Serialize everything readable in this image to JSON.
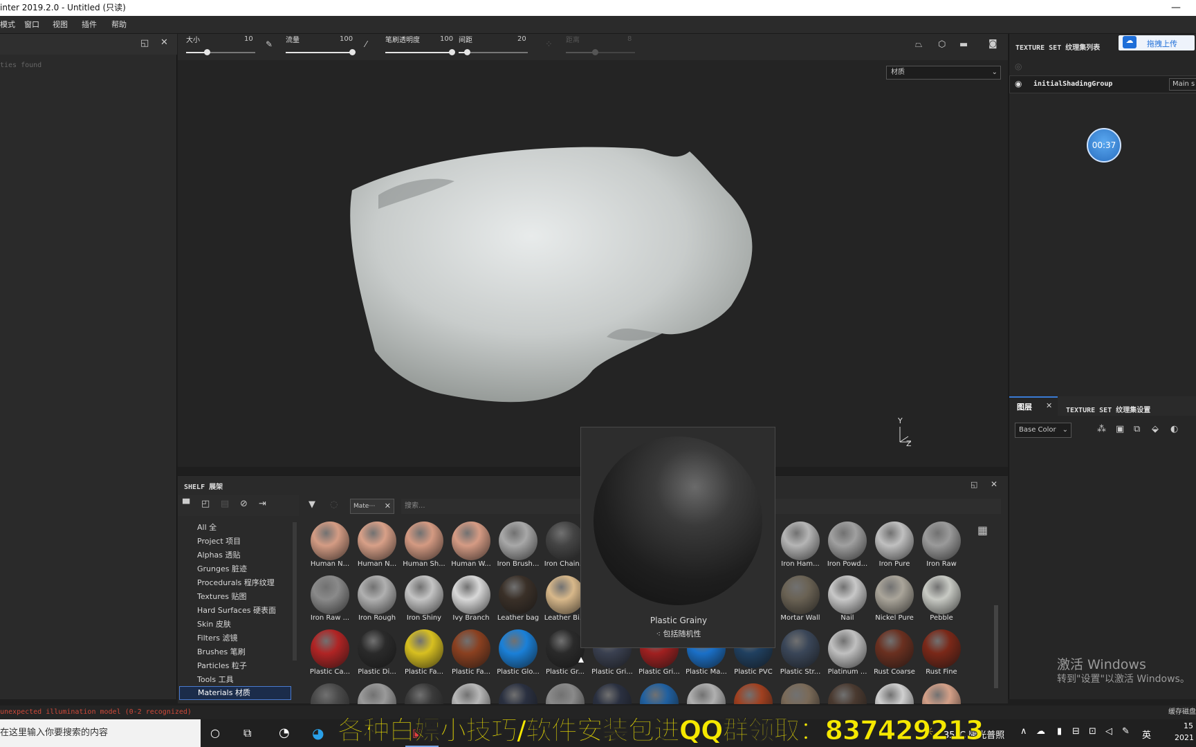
{
  "titlebar": {
    "title": "inter 2019.2.0 - Untitled (只读)",
    "minimize": "—"
  },
  "menu": [
    "模式",
    "窗口",
    "视图",
    "插件",
    "帮助"
  ],
  "leftpanel": {
    "not_found": "ties found"
  },
  "toolbar": {
    "size_label": "大小",
    "size_value": "10",
    "flow_label": "流量",
    "flow_value": "100",
    "opacity_label": "笔刷透明度",
    "opacity_value": "100",
    "spacing_label": "间距",
    "spacing_value": "20",
    "distance_label": "距离",
    "distance_value": "8"
  },
  "viewport": {
    "material_select": "材质",
    "axis_y": "Y",
    "axis_z": "Z"
  },
  "rightpanel": {
    "upload_button": "拖拽上传",
    "texture_set_list_title": "TEXTURE SET 纹理集列表",
    "shading_group": "initialShadingGroup",
    "main_label": "Main s",
    "timer": "00:37",
    "layers_tab": "图层",
    "settings_tab": "TEXTURE SET 纹理集设置",
    "channel": "Base Color"
  },
  "shelf": {
    "title": "SHELF 展架",
    "tag": "Mate⋯",
    "search_placeholder": "搜索...",
    "categories": [
      "All 全",
      "Project 项目",
      "Alphas 透贴",
      "Grunges 脏迹",
      "Procedurals 程序纹理",
      "Textures 贴图",
      "Hard Surfaces 硬表面",
      "Skin 皮肤",
      "Filters 滤镜",
      "Brushes 笔刷",
      "Particles 粒子",
      "Tools 工具",
      "Materials 材质"
    ],
    "rows": [
      [
        {
          "name": "Human N...",
          "color": "#d49c84"
        },
        {
          "name": "Human N...",
          "color": "#d8a088"
        },
        {
          "name": "Human Sh...",
          "color": "#d49a82"
        },
        {
          "name": "Human W...",
          "color": "#d59b84"
        },
        {
          "name": "Iron Brush...",
          "color": "#a8a8a8"
        },
        {
          "name": "Iron Chain...",
          "color": "#444444"
        },
        {
          "name": "",
          "color": ""
        },
        {
          "name": "",
          "color": ""
        },
        {
          "name": "",
          "color": ""
        },
        {
          "name": "",
          "color": ""
        },
        {
          "name": "Iron Ham...",
          "color": "#b5b5b5"
        },
        {
          "name": "Iron Powd...",
          "color": "#a0a0a0"
        },
        {
          "name": "Iron Pure",
          "color": "#c0c0c0"
        },
        {
          "name": "Iron Raw",
          "color": "#9a9a9a"
        }
      ],
      [
        {
          "name": "Iron Raw ...",
          "color": "#8a8a8a"
        },
        {
          "name": "Iron Rough",
          "color": "#b0b0b0"
        },
        {
          "name": "Iron Shiny",
          "color": "#c4c4c4"
        },
        {
          "name": "Ivy Branch",
          "color": "#d8d8d8"
        },
        {
          "name": "Leather bag",
          "color": "#3a3028"
        },
        {
          "name": "Leather Bi...",
          "color": "#d8b88a"
        },
        {
          "name": "",
          "color": ""
        },
        {
          "name": "",
          "color": ""
        },
        {
          "name": "",
          "color": ""
        },
        {
          "name": "",
          "color": ""
        },
        {
          "name": "Mortar Wall",
          "color": "#6a6254"
        },
        {
          "name": "Nail",
          "color": "#c8c8c8"
        },
        {
          "name": "Nickel Pure",
          "color": "#aaa59a"
        },
        {
          "name": "Pebble",
          "color": "#c8cac4"
        }
      ],
      [
        {
          "name": "Plastic Ca...",
          "color": "#b02424"
        },
        {
          "name": "Plastic Di...",
          "color": "#2a2a2a"
        },
        {
          "name": "Plastic Fa...",
          "color": "#d8c020"
        },
        {
          "name": "Plastic Fa...",
          "color": "#8a4020"
        },
        {
          "name": "Plastic Glo...",
          "color": "#1a80d8"
        },
        {
          "name": "Plastic Gr...",
          "color": "#2a2a2a"
        },
        {
          "name": "Plastic Gri...",
          "color": "#3a4050"
        },
        {
          "name": "Plastic Gri...",
          "color": "#a02020"
        },
        {
          "name": "Plastic Ma...",
          "color": "#1a70c8"
        },
        {
          "name": "Plastic PVC",
          "color": "#204060"
        },
        {
          "name": "Plastic Str...",
          "color": "#3a4658"
        },
        {
          "name": "Platinum ...",
          "color": "#c0c0c0"
        },
        {
          "name": "Rust Coarse",
          "color": "#6a3020"
        },
        {
          "name": "Rust Fine",
          "color": "#7a2818"
        }
      ],
      [
        {
          "name": "",
          "color": "#4a4a4a"
        },
        {
          "name": "",
          "color": "#9a9a9a"
        },
        {
          "name": "",
          "color": "#3a3a3a"
        },
        {
          "name": "",
          "color": "#b8b8b8"
        },
        {
          "name": "",
          "color": "#2a3040"
        },
        {
          "name": "",
          "color": "#8a8a8a"
        },
        {
          "name": "",
          "color": "#2a3040"
        },
        {
          "name": "",
          "color": "#2060a0"
        },
        {
          "name": "",
          "color": "#b0b0b0"
        },
        {
          "name": "",
          "color": "#a04020"
        },
        {
          "name": "",
          "color": "#7a6a58"
        },
        {
          "name": "",
          "color": "#4a3a30"
        },
        {
          "name": "",
          "color": "#d0d0d0"
        },
        {
          "name": "",
          "color": "#d4a088"
        }
      ]
    ]
  },
  "preview": {
    "name": "Plastic Grainy",
    "tag": "包括随机性"
  },
  "status": {
    "error": "unexpected illumination model (0-2 recognized)",
    "right": "缓存磁盘"
  },
  "windows": {
    "activate_title": "激活 Windows",
    "activate_sub": "转到\"设置\"以激活 Windows。"
  },
  "banner": "各种白嫖小技巧/软件安装包进QQ群领取：837429213",
  "taskbar": {
    "search_placeholder": "在这里输入你要搜索的内容",
    "weather": "35°C 陽光普照",
    "ime": "英",
    "time": "15",
    "date": "2021"
  }
}
